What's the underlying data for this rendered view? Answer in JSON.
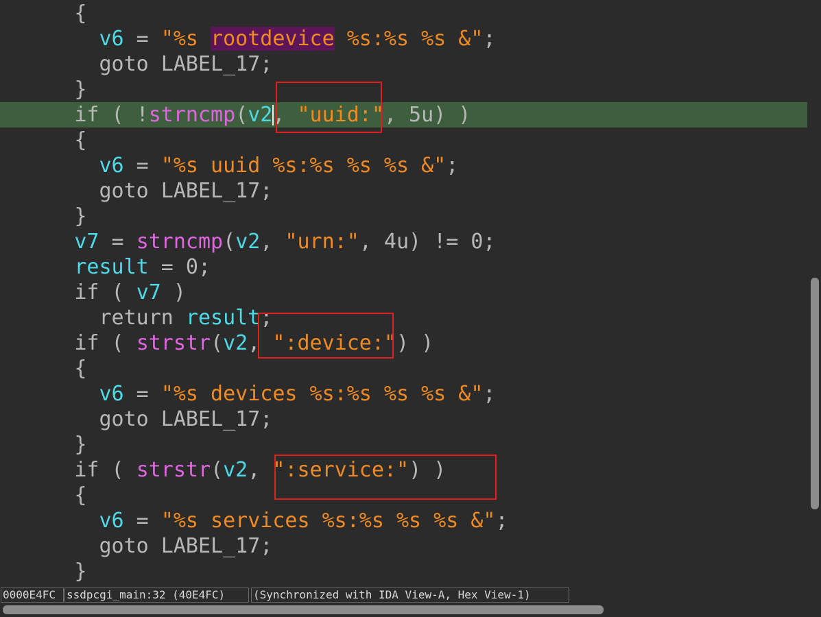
{
  "code_lines": [
    {
      "indent": "      ",
      "tokens": [
        {
          "t": "{",
          "c": "default"
        }
      ]
    },
    {
      "indent": "        ",
      "tokens": [
        {
          "t": "v6",
          "c": "var"
        },
        {
          "t": " = ",
          "c": "default"
        },
        {
          "t": "\"%s ",
          "c": "str"
        },
        {
          "t": "rootdevice",
          "c": "str",
          "bg": true
        },
        {
          "t": " %s:%s %s &\"",
          "c": "str"
        },
        {
          "t": ";",
          "c": "default"
        }
      ]
    },
    {
      "indent": "        ",
      "tokens": [
        {
          "t": "goto LABEL_17;",
          "c": "default"
        }
      ]
    },
    {
      "indent": "      ",
      "tokens": [
        {
          "t": "}",
          "c": "default"
        }
      ]
    },
    {
      "indent": "      ",
      "highlight": true,
      "tokens": [
        {
          "t": "if ( !",
          "c": "default"
        },
        {
          "t": "strncmp",
          "c": "func"
        },
        {
          "t": "(",
          "c": "default"
        },
        {
          "t": "v2",
          "c": "var"
        },
        {
          "t": ", ",
          "c": "default"
        },
        {
          "t": "\"uuid:\"",
          "c": "str"
        },
        {
          "t": ", 5u) )",
          "c": "default"
        }
      ]
    },
    {
      "indent": "      ",
      "tokens": [
        {
          "t": "{",
          "c": "default"
        }
      ]
    },
    {
      "indent": "        ",
      "tokens": [
        {
          "t": "v6",
          "c": "var"
        },
        {
          "t": " = ",
          "c": "default"
        },
        {
          "t": "\"%s uuid %s:%s %s %s &\"",
          "c": "str"
        },
        {
          "t": ";",
          "c": "default"
        }
      ]
    },
    {
      "indent": "        ",
      "tokens": [
        {
          "t": "goto LABEL_17;",
          "c": "default"
        }
      ]
    },
    {
      "indent": "      ",
      "tokens": [
        {
          "t": "}",
          "c": "default"
        }
      ]
    },
    {
      "indent": "      ",
      "tokens": [
        {
          "t": "v7",
          "c": "var"
        },
        {
          "t": " = ",
          "c": "default"
        },
        {
          "t": "strncmp",
          "c": "func"
        },
        {
          "t": "(",
          "c": "default"
        },
        {
          "t": "v2",
          "c": "var"
        },
        {
          "t": ", ",
          "c": "default"
        },
        {
          "t": "\"urn:\"",
          "c": "str"
        },
        {
          "t": ", 4u) != 0;",
          "c": "default"
        }
      ]
    },
    {
      "indent": "      ",
      "tokens": [
        {
          "t": "result",
          "c": "var"
        },
        {
          "t": " = 0;",
          "c": "default"
        }
      ]
    },
    {
      "indent": "      ",
      "tokens": [
        {
          "t": "if ( ",
          "c": "default"
        },
        {
          "t": "v7",
          "c": "var"
        },
        {
          "t": " )",
          "c": "default"
        }
      ]
    },
    {
      "indent": "        ",
      "tokens": [
        {
          "t": "return ",
          "c": "default"
        },
        {
          "t": "result",
          "c": "var"
        },
        {
          "t": ";",
          "c": "default"
        }
      ]
    },
    {
      "indent": "      ",
      "tokens": [
        {
          "t": "if ( ",
          "c": "default"
        },
        {
          "t": "strstr",
          "c": "func"
        },
        {
          "t": "(",
          "c": "default"
        },
        {
          "t": "v2",
          "c": "var"
        },
        {
          "t": ", ",
          "c": "default"
        },
        {
          "t": "\":device:\"",
          "c": "str"
        },
        {
          "t": ") )",
          "c": "default"
        }
      ]
    },
    {
      "indent": "      ",
      "tokens": [
        {
          "t": "{",
          "c": "default"
        }
      ]
    },
    {
      "indent": "        ",
      "tokens": [
        {
          "t": "v6",
          "c": "var"
        },
        {
          "t": " = ",
          "c": "default"
        },
        {
          "t": "\"%s devices %s:%s %s %s &\"",
          "c": "str"
        },
        {
          "t": ";",
          "c": "default"
        }
      ]
    },
    {
      "indent": "        ",
      "tokens": [
        {
          "t": "goto LABEL_17;",
          "c": "default"
        }
      ]
    },
    {
      "indent": "      ",
      "tokens": [
        {
          "t": "}",
          "c": "default"
        }
      ]
    },
    {
      "indent": "      ",
      "tokens": [
        {
          "t": "if ( ",
          "c": "default"
        },
        {
          "t": "strstr",
          "c": "func"
        },
        {
          "t": "(",
          "c": "default"
        },
        {
          "t": "v2",
          "c": "var"
        },
        {
          "t": ", ",
          "c": "default"
        },
        {
          "t": "\":service:\"",
          "c": "str"
        },
        {
          "t": ") )",
          "c": "default"
        }
      ]
    },
    {
      "indent": "      ",
      "tokens": [
        {
          "t": "{",
          "c": "default"
        }
      ]
    },
    {
      "indent": "        ",
      "tokens": [
        {
          "t": "v6",
          "c": "var"
        },
        {
          "t": " = ",
          "c": "default"
        },
        {
          "t": "\"%s services %s:%s %s %s &\"",
          "c": "str"
        },
        {
          "t": ";",
          "c": "default"
        }
      ]
    },
    {
      "indent": "        ",
      "tokens": [
        {
          "t": "goto LABEL_17;",
          "c": "default"
        }
      ]
    },
    {
      "indent": "      ",
      "tokens": [
        {
          "t": "}",
          "c": "default"
        }
      ]
    }
  ],
  "status": {
    "address": "0000E4FC",
    "location": "ssdpcgi_main:32 (40E4FC)",
    "sync": "(Synchronized with IDA View-A, Hex View-1)"
  },
  "colors": {
    "background": "#2b2b2b",
    "current_line": "#3e5f3d",
    "annotation_box": "#e02020"
  }
}
